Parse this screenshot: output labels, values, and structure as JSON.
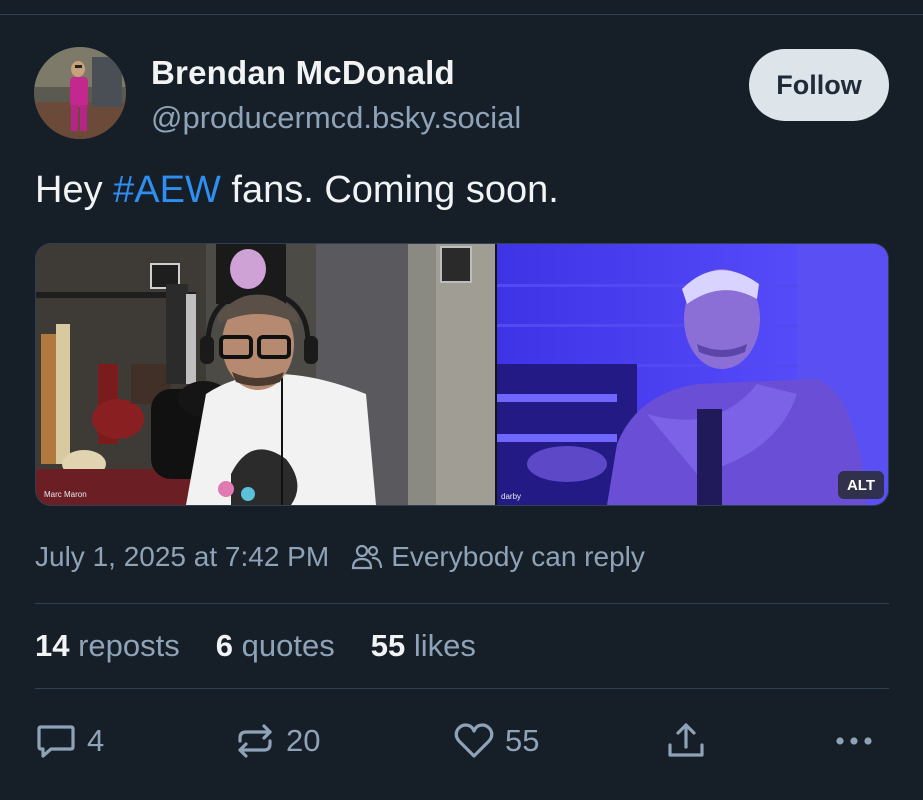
{
  "author": {
    "display_name": "Brendan McDonald",
    "handle": "@producermcd.bsky.social"
  },
  "follow_button": {
    "label": "Follow"
  },
  "post": {
    "text_before": "Hey ",
    "hashtag": "#AEW",
    "text_after": " fans. Coming soon."
  },
  "media": {
    "left_name_tag": "Marc Maron",
    "right_name_tag": "darby",
    "alt_badge": "ALT"
  },
  "meta": {
    "timestamp": "July 1, 2025 at 7:42 PM",
    "reply_setting": "Everybody can reply"
  },
  "stats": {
    "reposts_count": "14",
    "reposts_label": "reposts",
    "quotes_count": "6",
    "quotes_label": "quotes",
    "likes_count": "55",
    "likes_label": "likes"
  },
  "actions": {
    "reply_count": "4",
    "repost_count": "20",
    "like_count": "55"
  },
  "colors": {
    "background": "#161e27",
    "accent_link": "#2f8ff0",
    "muted_text": "#8fa3b8",
    "follow_button_bg": "#dde4ea"
  },
  "icons": [
    "avatar",
    "people-icon",
    "reply-icon",
    "repost-icon",
    "heart-icon",
    "share-icon",
    "more-icon"
  ]
}
